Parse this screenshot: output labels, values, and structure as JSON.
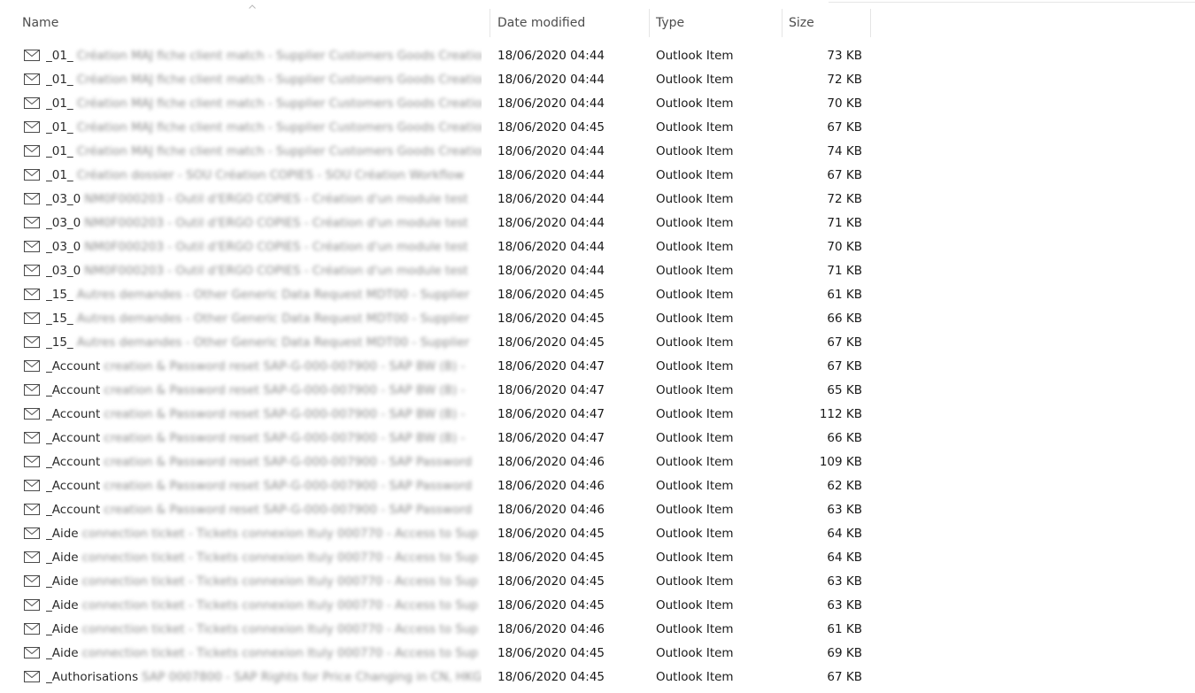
{
  "columns": {
    "name": "Name",
    "date": "Date modified",
    "type": "Type",
    "size": "Size"
  },
  "rows": [
    {
      "prefix": "_01_",
      "rest": "Création MAJ fiche client match - Supplier Customers Goods Creation",
      "date": "18/06/2020 04:44",
      "type": "Outlook Item",
      "size": "73 KB"
    },
    {
      "prefix": "_01_",
      "rest": "Création MAJ fiche client match - Supplier Customers Goods Creation",
      "date": "18/06/2020 04:44",
      "type": "Outlook Item",
      "size": "72 KB"
    },
    {
      "prefix": "_01_",
      "rest": "Création MAJ fiche client match - Supplier Customers Goods Creation",
      "date": "18/06/2020 04:44",
      "type": "Outlook Item",
      "size": "70 KB"
    },
    {
      "prefix": "_01_",
      "rest": "Création MAJ fiche client match - Supplier Customers Goods Creation",
      "date": "18/06/2020 04:45",
      "type": "Outlook Item",
      "size": "67 KB"
    },
    {
      "prefix": "_01_",
      "rest": "Création MAJ fiche client match - Supplier Customers Goods Creation",
      "date": "18/06/2020 04:44",
      "type": "Outlook Item",
      "size": "74 KB"
    },
    {
      "prefix": "_01_",
      "rest": "Création dossier - SOU Création COPIES - SOU Création Workflow",
      "date": "18/06/2020 04:44",
      "type": "Outlook Item",
      "size": "67 KB"
    },
    {
      "prefix": "_03_0",
      "rest": "NM0F000203 - Outil d'ERGO COPIES - Création d'un module test",
      "date": "18/06/2020 04:44",
      "type": "Outlook Item",
      "size": "72 KB"
    },
    {
      "prefix": "_03_0",
      "rest": "NM0F000203 - Outil d'ERGO COPIES - Création d'un module test",
      "date": "18/06/2020 04:44",
      "type": "Outlook Item",
      "size": "71 KB"
    },
    {
      "prefix": "_03_0",
      "rest": "NM0F000203 - Outil d'ERGO COPIES - Création d'un module test",
      "date": "18/06/2020 04:44",
      "type": "Outlook Item",
      "size": "70 KB"
    },
    {
      "prefix": "_03_0",
      "rest": "NM0F000203 - Outil d'ERGO COPIES - Création d'un module test",
      "date": "18/06/2020 04:44",
      "type": "Outlook Item",
      "size": "71 KB"
    },
    {
      "prefix": "_15_",
      "rest": "Autres demandes - Other Generic Data Request MDT00 - Supplier",
      "date": "18/06/2020 04:45",
      "type": "Outlook Item",
      "size": "61 KB"
    },
    {
      "prefix": "_15_",
      "rest": "Autres demandes - Other Generic Data Request MDT00 - Supplier",
      "date": "18/06/2020 04:45",
      "type": "Outlook Item",
      "size": "66 KB"
    },
    {
      "prefix": "_15_",
      "rest": "Autres demandes - Other Generic Data Request MDT00 - Supplier",
      "date": "18/06/2020 04:45",
      "type": "Outlook Item",
      "size": "67 KB"
    },
    {
      "prefix": "_Account",
      "rest": "creation & Password reset SAP-G-000-007900 - SAP BW (B) -",
      "date": "18/06/2020 04:47",
      "type": "Outlook Item",
      "size": "67 KB"
    },
    {
      "prefix": "_Account",
      "rest": "creation & Password reset SAP-G-000-007900 - SAP BW (B) -",
      "date": "18/06/2020 04:47",
      "type": "Outlook Item",
      "size": "65 KB"
    },
    {
      "prefix": "_Account",
      "rest": "creation & Password reset SAP-G-000-007900 - SAP BW (B) -",
      "date": "18/06/2020 04:47",
      "type": "Outlook Item",
      "size": "112 KB"
    },
    {
      "prefix": "_Account",
      "rest": "creation & Password reset SAP-G-000-007900 - SAP BW (B) -",
      "date": "18/06/2020 04:47",
      "type": "Outlook Item",
      "size": "66 KB"
    },
    {
      "prefix": "_Account",
      "rest": "creation & Password reset SAP-G-000-007900 - SAP Password",
      "date": "18/06/2020 04:46",
      "type": "Outlook Item",
      "size": "109 KB"
    },
    {
      "prefix": "_Account",
      "rest": "creation & Password reset SAP-G-000-007900 - SAP Password",
      "date": "18/06/2020 04:46",
      "type": "Outlook Item",
      "size": "62 KB"
    },
    {
      "prefix": "_Account",
      "rest": "creation & Password reset SAP-G-000-007900 - SAP Password",
      "date": "18/06/2020 04:46",
      "type": "Outlook Item",
      "size": "63 KB"
    },
    {
      "prefix": "_Aide",
      "rest": "connection ticket - Tickets connexion Ituly 000770 - Access to Sup",
      "date": "18/06/2020 04:45",
      "type": "Outlook Item",
      "size": "64 KB"
    },
    {
      "prefix": "_Aide",
      "rest": "connection ticket - Tickets connexion Ituly 000770 - Access to Sup",
      "date": "18/06/2020 04:45",
      "type": "Outlook Item",
      "size": "64 KB"
    },
    {
      "prefix": "_Aide",
      "rest": "connection ticket - Tickets connexion Ituly 000770 - Access to Sup",
      "date": "18/06/2020 04:45",
      "type": "Outlook Item",
      "size": "63 KB"
    },
    {
      "prefix": "_Aide",
      "rest": "connection ticket - Tickets connexion Ituly 000770 - Access to Sup",
      "date": "18/06/2020 04:45",
      "type": "Outlook Item",
      "size": "63 KB"
    },
    {
      "prefix": "_Aide",
      "rest": "connection ticket - Tickets connexion Ituly 000770 - Access to Sup",
      "date": "18/06/2020 04:46",
      "type": "Outlook Item",
      "size": "61 KB"
    },
    {
      "prefix": "_Aide",
      "rest": "connection ticket - Tickets connexion Ituly 000770 - Access to Sup",
      "date": "18/06/2020 04:45",
      "type": "Outlook Item",
      "size": "69 KB"
    },
    {
      "prefix": "_Authorisations",
      "rest": "SAP 0007800 - SAP Rights for Price Changing in CN, HKG",
      "date": "18/06/2020 04:45",
      "type": "Outlook Item",
      "size": "67 KB"
    }
  ]
}
